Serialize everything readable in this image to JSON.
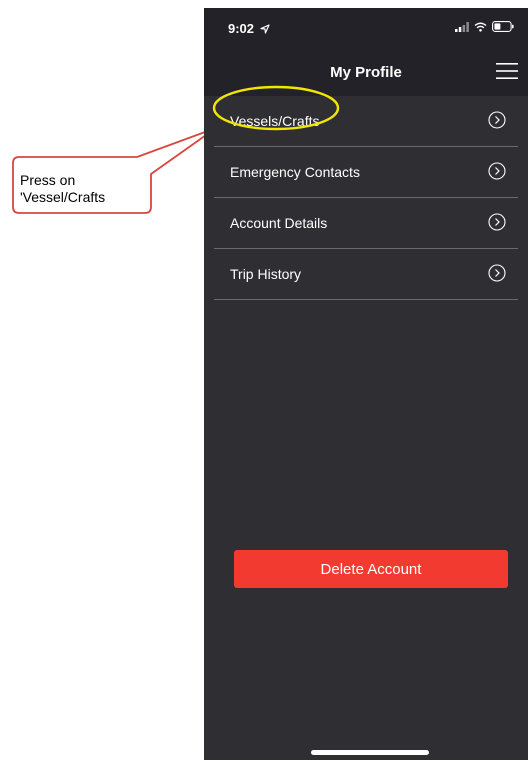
{
  "annotation": {
    "callout_text": "Press on 'Vessel/Crafts",
    "callout_fill": "#ffffff",
    "callout_stroke": "#d9463e",
    "highlight_color": "#f0e600"
  },
  "status_bar": {
    "time": "9:02"
  },
  "header": {
    "title": "My Profile",
    "menu_icon": "hamburger-menu-icon"
  },
  "menu": {
    "items": [
      {
        "label": "Vessels/Crafts",
        "icon": "chevron-right-circle-icon"
      },
      {
        "label": "Emergency Contacts",
        "icon": "chevron-right-circle-icon"
      },
      {
        "label": "Account Details",
        "icon": "chevron-right-circle-icon"
      },
      {
        "label": "Trip History",
        "icon": "chevron-right-circle-icon"
      }
    ]
  },
  "actions": {
    "delete_label": "Delete Account",
    "delete_color": "#f23a30"
  },
  "colors": {
    "background": "#2f2e33",
    "header": "#232228",
    "divider": "#6a6970",
    "text": "#ffffff"
  }
}
